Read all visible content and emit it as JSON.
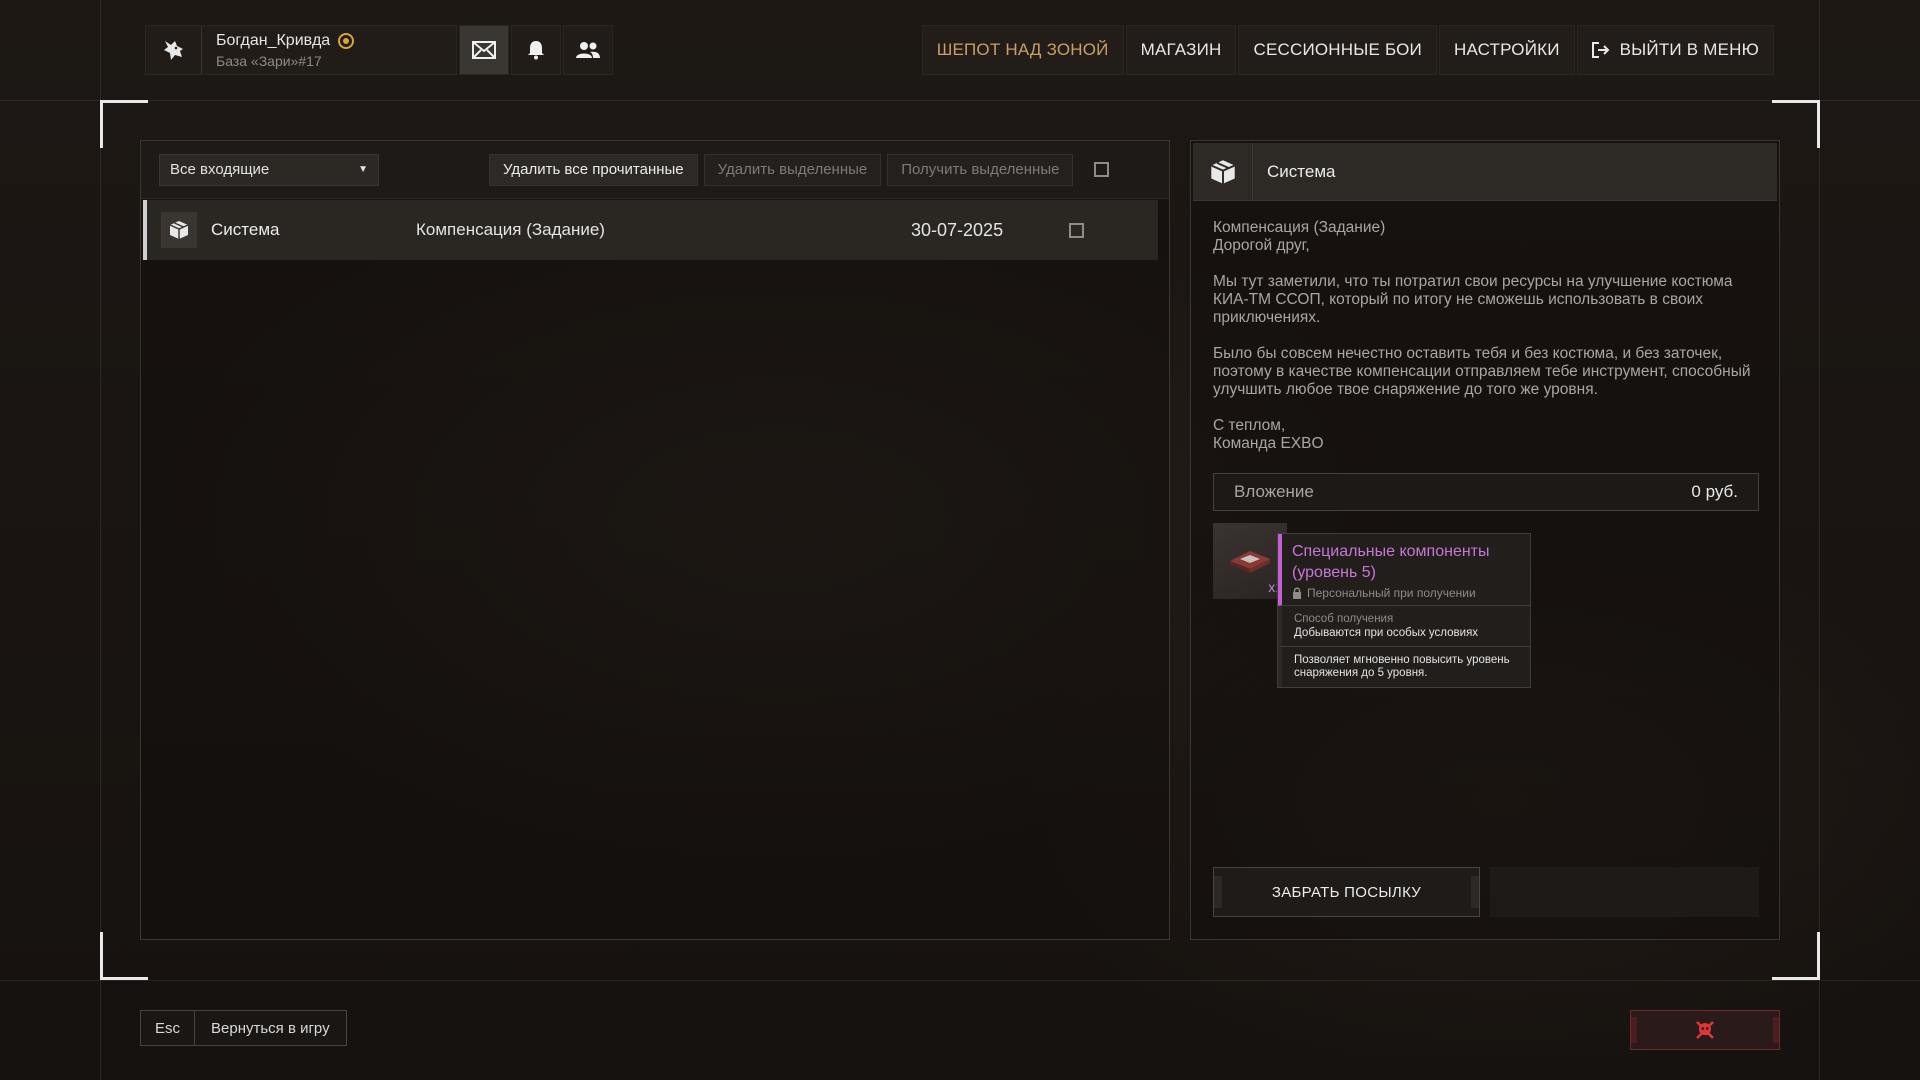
{
  "profile": {
    "name": "Богдан_Кривда",
    "base": "База «Зари»#17"
  },
  "topnav": {
    "whisper": "ШЕПОТ НАД ЗОНОЙ",
    "shop": "МАГАЗИН",
    "session_battles": "СЕССИОННЫЕ БОИ",
    "settings": "НАСТРОЙКИ",
    "exit": "ВЫЙТИ В МЕНЮ"
  },
  "toolbar": {
    "filter_value": "Все входящие",
    "delete_read": "Удалить все прочитанные",
    "delete_selected": "Удалить выделенные",
    "get_selected": "Получить выделенные"
  },
  "mail_list": [
    {
      "sender": "Система",
      "subject": "Компенсация (Задание)",
      "date": "30-07-2025"
    }
  ],
  "detail": {
    "sender": "Система",
    "title": "Компенсация (Задание)",
    "greeting": "Дорогой друг,",
    "para1": "Мы тут заметили, что ты потратил свои ресурсы на улучшение костюма КИА-ТМ ССОП, который по итогу не сможешь использовать в своих приключениях.",
    "para2": "Было бы совсем нечестно оставить тебя и без костюма, и без заточек, поэтому в качестве компенсации отправляем тебе инструмент, способный улучшить любое твое снаряжение до того же уровня.",
    "sign1": "С теплом,",
    "sign2": "Команда EXBO",
    "attachment_label": "Вложение",
    "attachment_value": "0 руб.",
    "item_qty": "x1",
    "item_name": "Специальные компоненты (уровень 5)",
    "item_personal": "Персональный при получении",
    "item_method_label": "Способ получения",
    "item_method_value": "Добываются при особых условиях",
    "item_desc": "Позволяет мгновенно повысить уровень снаряжения до 5 уровня.",
    "claim_button": "ЗАБРАТЬ ПОСЫЛКУ"
  },
  "bottom": {
    "esc_key": "Esc",
    "back_label": "Вернуться в игру"
  },
  "icons": {
    "profile_logo": "wolf-logo-icon",
    "mail": "envelope-icon",
    "bell": "bell-icon",
    "friends": "friends-icon",
    "exit": "exit-icon",
    "system": "box-icon",
    "danger": "skull-icon",
    "lock": "lock-icon"
  },
  "colors": {
    "accent_nav": "#c7a066",
    "item_rarity": "#c876d8",
    "danger": "#e0353a",
    "badge": "#d9a63a"
  }
}
